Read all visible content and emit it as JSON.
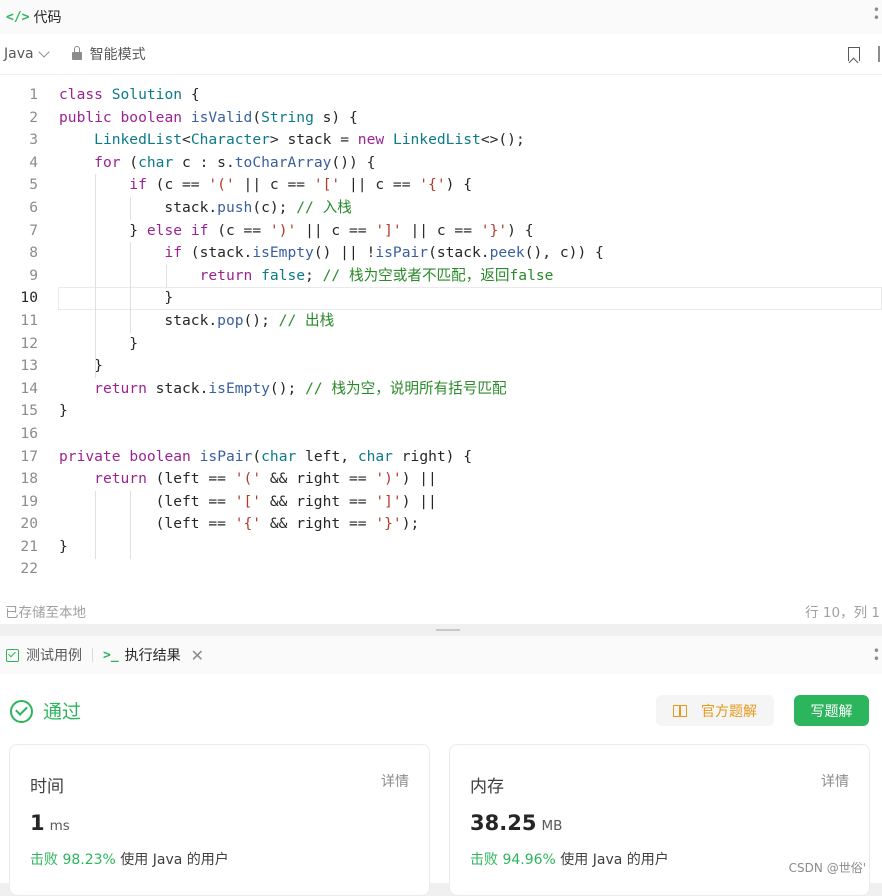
{
  "titlebar": {
    "icon": "</>",
    "title": "代码"
  },
  "toolbar": {
    "language": "Java",
    "mode": "智能模式"
  },
  "editor": {
    "active_line": 10,
    "lines": [
      {
        "n": "1",
        "html": "<span class=\"kw\">class</span> <span class=\"ty\">Solution</span> {"
      },
      {
        "n": "2",
        "html": "<span class=\"kw\">public</span> <span class=\"kw\">boolean</span> <span class=\"fn\">isValid</span>(<span class=\"ty\">String</span> s) {"
      },
      {
        "n": "3",
        "html": "    <span class=\"ty\">LinkedList</span>&lt;<span class=\"ty\">Character</span>&gt; stack = <span class=\"kw\">new</span> <span class=\"ty\">LinkedList</span>&lt;&gt;();"
      },
      {
        "n": "4",
        "html": "    <span class=\"kw\">for</span> (<span class=\"ctype\">char</span> c : s.<span class=\"fn\">toCharArray</span>()) {"
      },
      {
        "n": "5",
        "html": "        <span class=\"kw\">if</span> (c == <span class=\"st\">'('</span> || c == <span class=\"st\">'['</span> || c == <span class=\"st\">'{'</span>) {"
      },
      {
        "n": "6",
        "html": "            stack.<span class=\"fn\">push</span>(c); <span class=\"cm\">// 入栈</span>"
      },
      {
        "n": "7",
        "html": "        } <span class=\"kw\">else</span> <span class=\"kw\">if</span> (c == <span class=\"st\">')'</span> || c == <span class=\"st\">']'</span> || c == <span class=\"st\">'}'</span>) {"
      },
      {
        "n": "8",
        "html": "            <span class=\"kw\">if</span> (stack.<span class=\"fn\">isEmpty</span>() || !<span class=\"fn\">isPair</span>(stack.<span class=\"fn\">peek</span>(), c)) {"
      },
      {
        "n": "9",
        "html": "                <span class=\"kw\">return</span> <span class=\"ctype\">false</span>; <span class=\"cm\">// 栈为空或者不匹配，返回false</span>"
      },
      {
        "n": "10",
        "html": "            }"
      },
      {
        "n": "11",
        "html": "            stack.<span class=\"fn\">pop</span>(); <span class=\"cm\">// 出栈</span>"
      },
      {
        "n": "12",
        "html": "        }"
      },
      {
        "n": "13",
        "html": "    }"
      },
      {
        "n": "14",
        "html": "    <span class=\"kw\">return</span> stack.<span class=\"fn\">isEmpty</span>(); <span class=\"cm\">// 栈为空，说明所有括号匹配</span>"
      },
      {
        "n": "15",
        "html": "}"
      },
      {
        "n": "16",
        "html": ""
      },
      {
        "n": "17",
        "html": "<span class=\"kw\">private</span> <span class=\"kw\">boolean</span> <span class=\"fn\">isPair</span>(<span class=\"ctype\">char</span> left, <span class=\"ctype\">char</span> right) {"
      },
      {
        "n": "18",
        "html": "    <span class=\"kw\">return</span> (left == <span class=\"st\">'('</span> &amp;&amp; right == <span class=\"st\">')'</span>) ||"
      },
      {
        "n": "19",
        "html": "           (left == <span class=\"st\">'['</span> &amp;&amp; right == <span class=\"st\">']'</span>) ||"
      },
      {
        "n": "20",
        "html": "           (left == <span class=\"st\">'{'</span> &amp;&amp; right == <span class=\"st\">'}'</span>);"
      },
      {
        "n": "21",
        "html": "}"
      },
      {
        "n": "22",
        "html": ""
      }
    ]
  },
  "statusbar": {
    "left": "已存储至本地",
    "right": "行 10，列 1"
  },
  "bottom_tabs": {
    "test_cases": "测试用例",
    "results": "执行结果"
  },
  "result": {
    "status": "通过",
    "official_solution": "官方题解",
    "write_solution": "写题解",
    "time": {
      "title": "时间",
      "detail": "详情",
      "value": "1",
      "unit": "ms",
      "beat_label": "击败",
      "beat_pct": "98.23%",
      "beat_suffix": "使用 Java 的用户"
    },
    "memory": {
      "title": "内存",
      "detail": "详情",
      "value": "38.25",
      "unit": "MB",
      "beat_label": "击败",
      "beat_pct": "94.96%",
      "beat_suffix": "使用 Java 的用户"
    }
  },
  "watermark": "CSDN @世俗'"
}
